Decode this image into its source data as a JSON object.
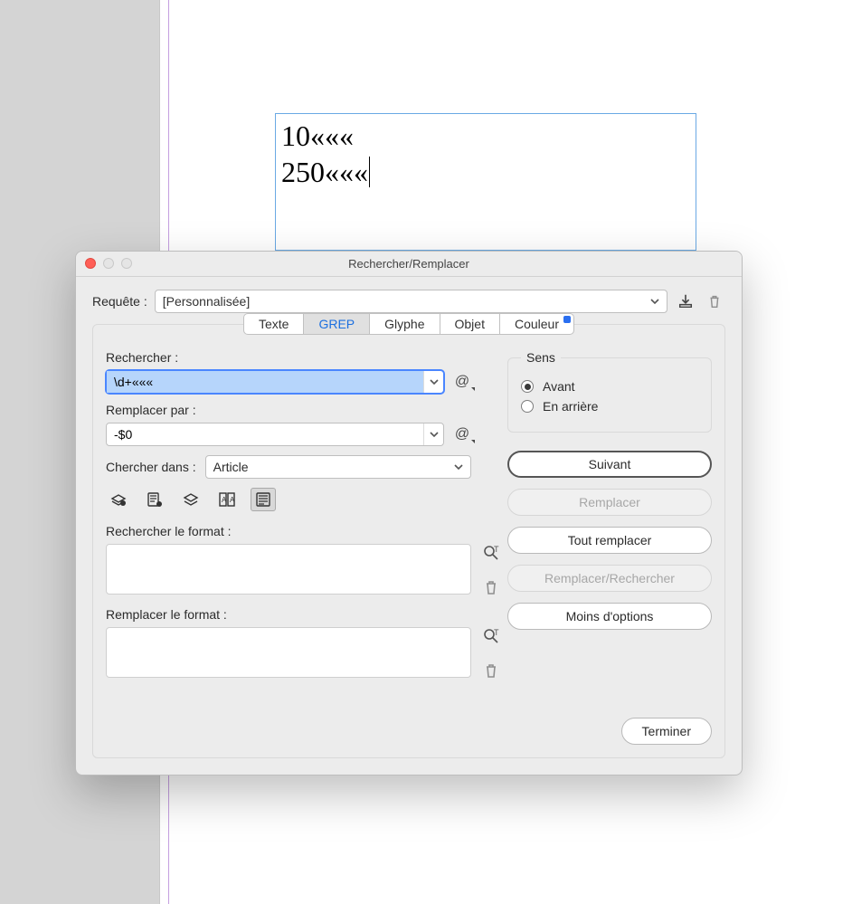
{
  "document": {
    "line1": "10«««",
    "line2": "250«««"
  },
  "dialog": {
    "title": "Rechercher/Remplacer",
    "query_label": "Requête :",
    "query_value": "[Personnalisée]",
    "tabs": {
      "texte": "Texte",
      "grep": "GREP",
      "glyphe": "Glyphe",
      "objet": "Objet",
      "couleur": "Couleur"
    },
    "find_label": "Rechercher :",
    "find_value": "\\d+«««",
    "replace_label": "Remplacer par :",
    "replace_value": "-$0",
    "search_in_label": "Chercher dans :",
    "search_in_value": "Article",
    "find_format_label": "Rechercher le format :",
    "replace_format_label": "Remplacer le format :",
    "sens": {
      "title": "Sens",
      "avant": "Avant",
      "arriere": "En arrière"
    },
    "buttons": {
      "suivant": "Suivant",
      "remplacer": "Remplacer",
      "tout_remplacer": "Tout remplacer",
      "remplacer_rechercher": "Remplacer/Rechercher",
      "moins_options": "Moins d'options",
      "terminer": "Terminer"
    }
  }
}
